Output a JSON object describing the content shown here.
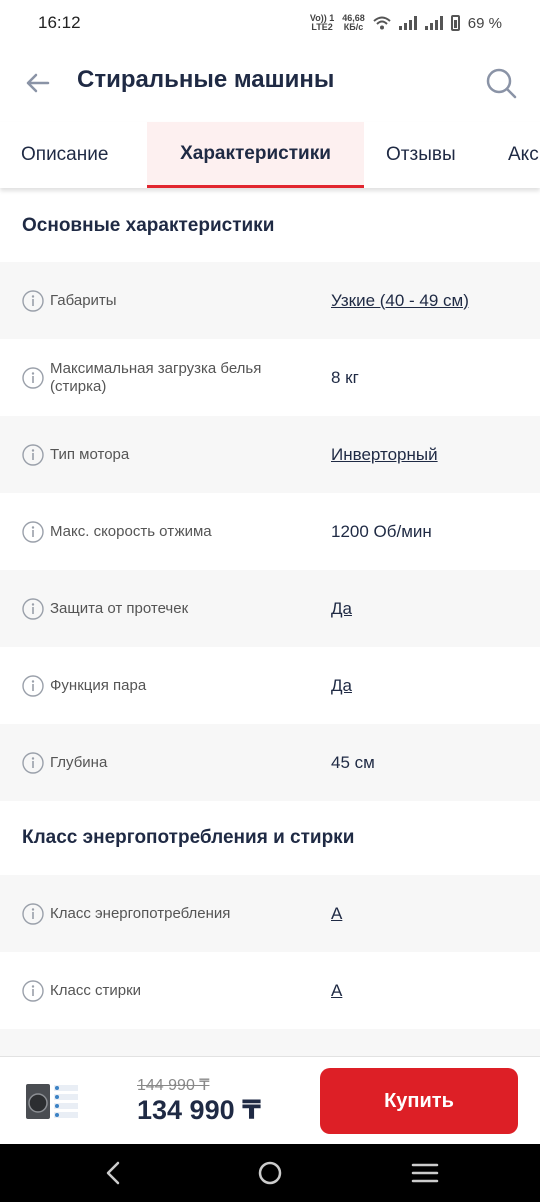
{
  "status": {
    "time": "16:12",
    "net_top": "Vo)) 1",
    "net_bottom": "LTE2",
    "speed_top": "46,68",
    "speed_bottom": "КБ/с",
    "battery": "69 %"
  },
  "header": {
    "title": "Стиральные машины",
    "back_icon": "arrow-left-icon",
    "search_icon": "search-icon"
  },
  "tabs": [
    {
      "label": "Описание"
    },
    {
      "label": "Характеристики",
      "active": true
    },
    {
      "label": "Отзывы"
    },
    {
      "label": "Акс"
    }
  ],
  "sections": [
    {
      "title": "Основные характеристики",
      "rows": [
        {
          "label": "Габариты",
          "value": "Узкие (40 - 49 см)",
          "link": true
        },
        {
          "label": "Максимальная загрузка белья (стирка)",
          "value": "8 кг",
          "link": false
        },
        {
          "label": "Тип мотора",
          "value": "Инверторный",
          "link": true
        },
        {
          "label": "Макс. скорость отжима",
          "value": "1200 Об/мин",
          "link": false
        },
        {
          "label": "Защита от протечек",
          "value": "Да",
          "link": true
        },
        {
          "label": "Функция пара",
          "value": "Да",
          "link": true
        },
        {
          "label": "Глубина",
          "value": "45 см",
          "link": false
        }
      ]
    },
    {
      "title": "Класс энергопотребления и стирки",
      "rows": [
        {
          "label": "Класс энергопотребления",
          "value": "A",
          "link": true
        },
        {
          "label": "Класс стирки",
          "value": "A",
          "link": true
        }
      ]
    }
  ],
  "bottom": {
    "old_price": "144 990 ₸",
    "price": "134 990 ₸",
    "buy_label": "Купить"
  },
  "colors": {
    "accent": "#dd1f26",
    "text": "#1f2a44",
    "row_bg": "#f7f7f7"
  }
}
